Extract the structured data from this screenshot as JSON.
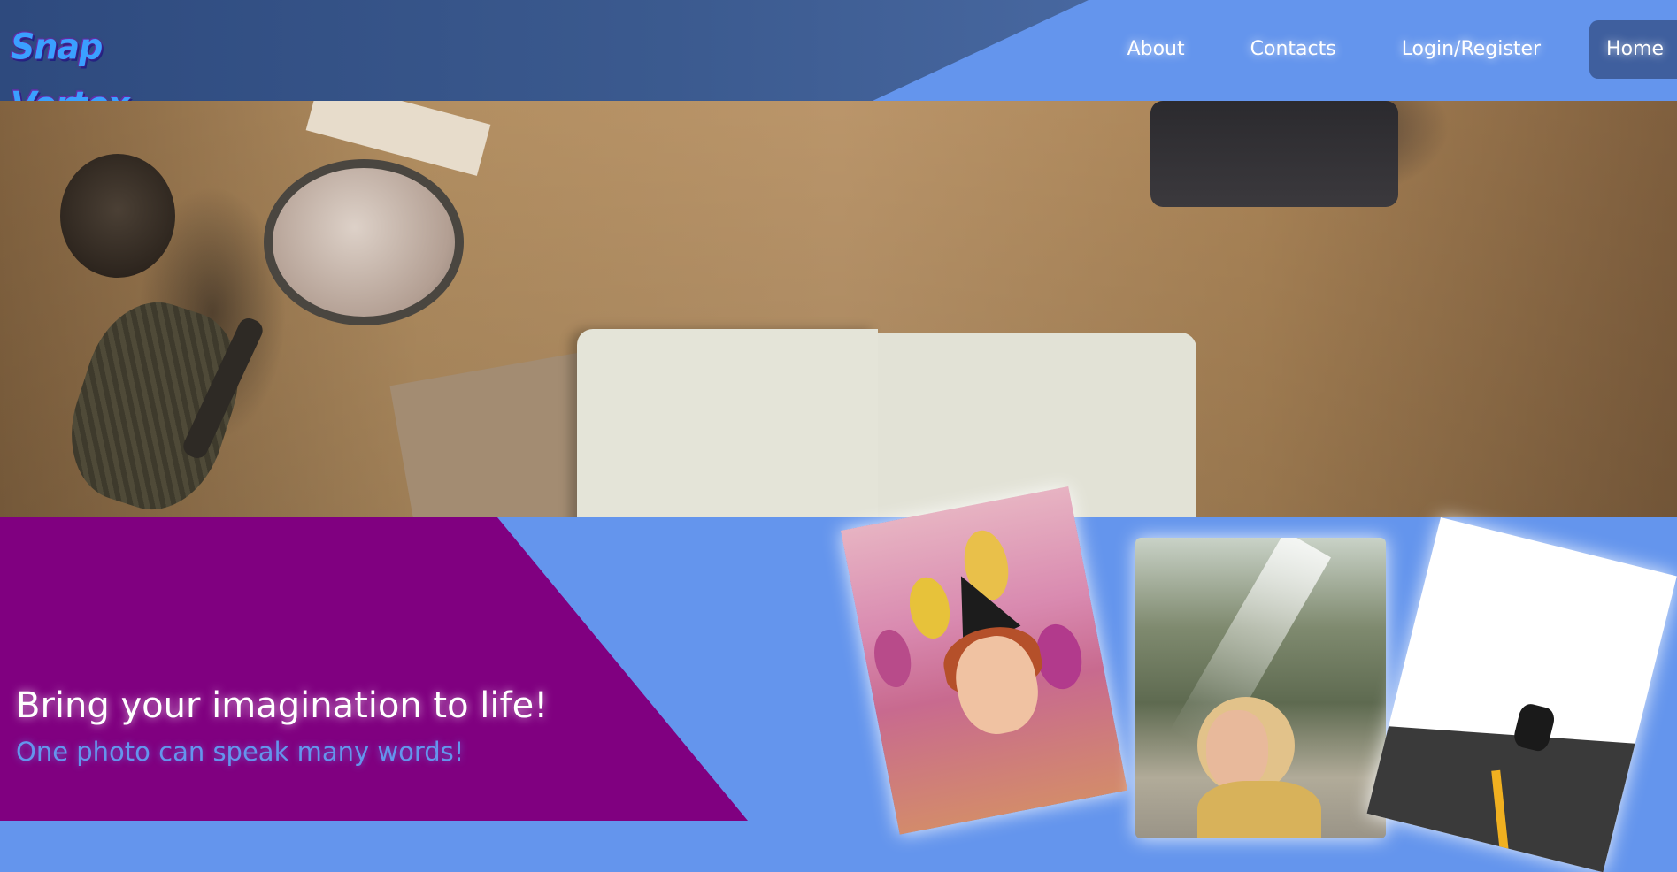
{
  "header": {
    "logo_text": "Snap Vortex",
    "nav": [
      {
        "label": "About"
      },
      {
        "label": "Contacts"
      },
      {
        "label": "Login/Register"
      },
      {
        "label": "Home",
        "active": true
      }
    ]
  },
  "hero": {
    "image": "banner-photo",
    "description_icon": "map-notebook-camera-image"
  },
  "intro": {
    "tagline": "Bring your imagination to life!",
    "subtagline": "One photo can speak many words!"
  },
  "gallery": [
    {
      "icon": "party-woman-photo"
    },
    {
      "icon": "forest-woman-photo"
    },
    {
      "icon": "jumping-man-photo"
    }
  ],
  "colors": {
    "accent_blue": "#6495ED",
    "purple": "#800080",
    "white": "#FFFFFF"
  }
}
